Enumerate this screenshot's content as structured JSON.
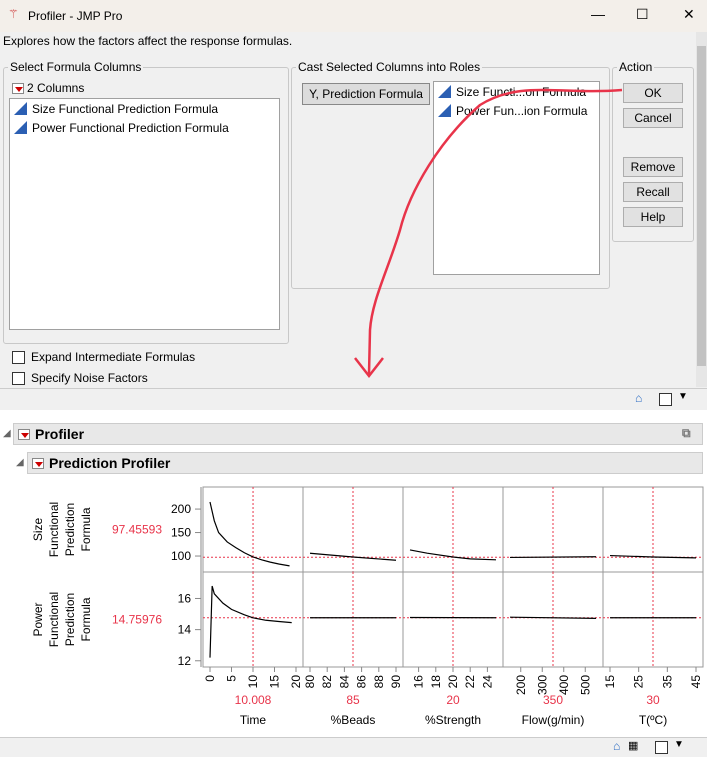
{
  "window": {
    "title": "Profiler - JMP Pro",
    "minimize": "—",
    "maximize": "☐",
    "close": "✕"
  },
  "description": "Explores how the factors affect the response formulas.",
  "select_columns": {
    "legend": "Select Formula Columns",
    "count": "2 Columns",
    "items": [
      "Size Functional Prediction Formula",
      "Power Functional Prediction Formula"
    ]
  },
  "cast_roles": {
    "legend": "Cast Selected Columns into Roles",
    "role_button": "Y, Prediction Formula",
    "items": [
      "Size Functi...on Formula",
      "Power Fun...ion Formula"
    ]
  },
  "action": {
    "legend": "Action",
    "ok": "OK",
    "cancel": "Cancel",
    "remove": "Remove",
    "recall": "Recall",
    "help": "Help"
  },
  "options": {
    "expand": "Expand Intermediate Formulas",
    "noise": "Specify Noise Factors"
  },
  "report": {
    "profiler": "Profiler",
    "prediction_profiler": "Prediction Profiler"
  },
  "colors": {
    "red": "#e8344a",
    "annotation": "#e8344a",
    "curve": "#000000"
  },
  "chart_data": {
    "type": "line",
    "responses": [
      {
        "label": [
          "Size",
          "Functional",
          "Prediction",
          "Formula"
        ],
        "current": "97.45593",
        "ylim": [
          66,
          247
        ],
        "ticks": [
          100,
          150,
          200
        ]
      },
      {
        "label": [
          "Power",
          "Functional",
          "Prediction",
          "Formula"
        ],
        "current": "14.75976",
        "ylim": [
          11.6,
          17.7
        ],
        "ticks": [
          12,
          14,
          16
        ]
      }
    ],
    "factors": [
      {
        "name": "Time",
        "current": "10.008",
        "value": 10.008,
        "xlim": [
          0,
          20
        ],
        "ticks": [
          0,
          5,
          10,
          15,
          20
        ],
        "curves": [
          [
            [
              0,
              215
            ],
            [
              1,
              175
            ],
            [
              2,
              150
            ],
            [
              4,
              130
            ],
            [
              6,
              118
            ],
            [
              8,
              107
            ],
            [
              10,
              98
            ],
            [
              12,
              92
            ],
            [
              14,
              87
            ],
            [
              16,
              83
            ],
            [
              18.5,
              79
            ]
          ],
          [
            [
              0,
              12.2
            ],
            [
              0.5,
              16.8
            ],
            [
              1,
              16.3
            ],
            [
              3,
              15.7
            ],
            [
              5,
              15.3
            ],
            [
              8,
              14.95
            ],
            [
              10,
              14.76
            ],
            [
              13,
              14.6
            ],
            [
              16,
              14.52
            ],
            [
              19,
              14.45
            ]
          ]
        ]
      },
      {
        "name": "%Beads",
        "current": "85",
        "value": 85,
        "xlim": [
          80,
          90
        ],
        "ticks": [
          80,
          82,
          84,
          86,
          88,
          90
        ],
        "curves": [
          [
            [
              80,
              106
            ],
            [
              85,
              98
            ],
            [
              90,
              91
            ]
          ],
          [
            [
              80,
              14.76
            ],
            [
              90,
              14.76
            ]
          ]
        ]
      },
      {
        "name": "%Strength",
        "current": "20",
        "value": 20,
        "xlim": [
          15,
          25
        ],
        "ticks": [
          16,
          18,
          20,
          22,
          24
        ],
        "curves": [
          [
            [
              15,
              113
            ],
            [
              17,
              106
            ],
            [
              20,
              98
            ],
            [
              22,
              94
            ],
            [
              25,
              92
            ]
          ],
          [
            [
              15,
              14.78
            ],
            [
              25,
              14.76
            ]
          ]
        ]
      },
      {
        "name": "Flow(g/min)",
        "current": "350",
        "value": 350,
        "xlim": [
          150,
          550
        ],
        "ticks": [
          200,
          300,
          400,
          500
        ],
        "curves": [
          [
            [
              150,
              97
            ],
            [
              550,
              98.5
            ]
          ],
          [
            [
              150,
              14.8
            ],
            [
              550,
              14.72
            ]
          ]
        ]
      },
      {
        "name": "T(ºC)",
        "current": "30",
        "value": 30,
        "xlim": [
          15,
          45
        ],
        "ticks": [
          15,
          25,
          35,
          45
        ],
        "curves": [
          [
            [
              15,
              101
            ],
            [
              30,
              98
            ],
            [
              45,
              96
            ]
          ],
          [
            [
              15,
              14.76
            ],
            [
              45,
              14.76
            ]
          ]
        ]
      }
    ]
  }
}
